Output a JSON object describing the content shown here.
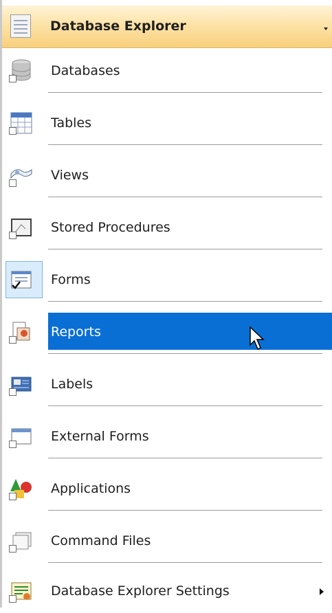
{
  "header": {
    "title": "Database Explorer"
  },
  "menu": {
    "items": [
      {
        "label": "Databases",
        "icon": "database-icon"
      },
      {
        "label": "Tables",
        "icon": "table-icon"
      },
      {
        "label": "Views",
        "icon": "views-icon"
      },
      {
        "label": "Stored Procedures",
        "icon": "stored-procedure-icon"
      },
      {
        "label": "Forms",
        "icon": "form-icon",
        "checked": true
      },
      {
        "label": "Reports",
        "icon": "report-icon",
        "highlighted": true
      },
      {
        "label": "Labels",
        "icon": "label-icon"
      },
      {
        "label": "External Forms",
        "icon": "external-form-icon"
      },
      {
        "label": "Applications",
        "icon": "applications-icon"
      },
      {
        "label": "Command Files",
        "icon": "command-files-icon"
      },
      {
        "label": "Database Explorer Settings",
        "icon": "settings-icon",
        "submenu": true
      }
    ]
  },
  "colors": {
    "highlight": "#0a6fd4",
    "header_top": "#fff3d6",
    "header_bottom": "#f8d07d"
  }
}
